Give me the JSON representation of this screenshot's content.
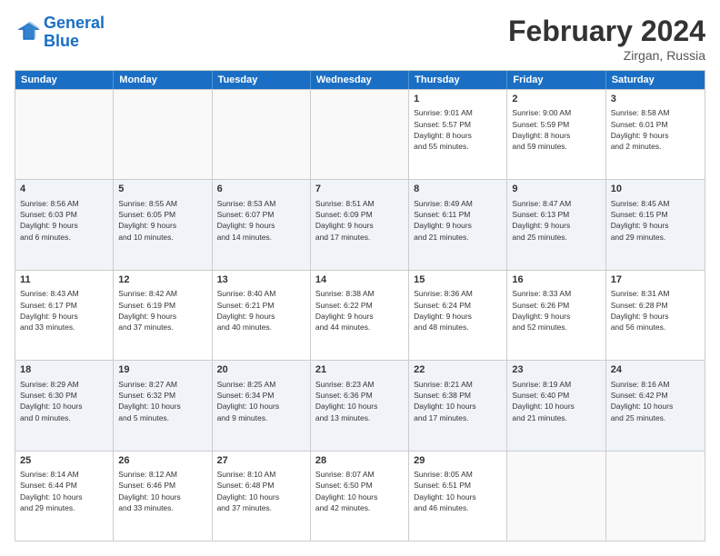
{
  "logo": {
    "line1": "General",
    "line2": "Blue"
  },
  "title": "February 2024",
  "location": "Zirgan, Russia",
  "days_of_week": [
    "Sunday",
    "Monday",
    "Tuesday",
    "Wednesday",
    "Thursday",
    "Friday",
    "Saturday"
  ],
  "rows": [
    [
      {
        "day": "",
        "info": ""
      },
      {
        "day": "",
        "info": ""
      },
      {
        "day": "",
        "info": ""
      },
      {
        "day": "",
        "info": ""
      },
      {
        "day": "1",
        "info": "Sunrise: 9:01 AM\nSunset: 5:57 PM\nDaylight: 8 hours\nand 55 minutes."
      },
      {
        "day": "2",
        "info": "Sunrise: 9:00 AM\nSunset: 5:59 PM\nDaylight: 8 hours\nand 59 minutes."
      },
      {
        "day": "3",
        "info": "Sunrise: 8:58 AM\nSunset: 6:01 PM\nDaylight: 9 hours\nand 2 minutes."
      }
    ],
    [
      {
        "day": "4",
        "info": "Sunrise: 8:56 AM\nSunset: 6:03 PM\nDaylight: 9 hours\nand 6 minutes."
      },
      {
        "day": "5",
        "info": "Sunrise: 8:55 AM\nSunset: 6:05 PM\nDaylight: 9 hours\nand 10 minutes."
      },
      {
        "day": "6",
        "info": "Sunrise: 8:53 AM\nSunset: 6:07 PM\nDaylight: 9 hours\nand 14 minutes."
      },
      {
        "day": "7",
        "info": "Sunrise: 8:51 AM\nSunset: 6:09 PM\nDaylight: 9 hours\nand 17 minutes."
      },
      {
        "day": "8",
        "info": "Sunrise: 8:49 AM\nSunset: 6:11 PM\nDaylight: 9 hours\nand 21 minutes."
      },
      {
        "day": "9",
        "info": "Sunrise: 8:47 AM\nSunset: 6:13 PM\nDaylight: 9 hours\nand 25 minutes."
      },
      {
        "day": "10",
        "info": "Sunrise: 8:45 AM\nSunset: 6:15 PM\nDaylight: 9 hours\nand 29 minutes."
      }
    ],
    [
      {
        "day": "11",
        "info": "Sunrise: 8:43 AM\nSunset: 6:17 PM\nDaylight: 9 hours\nand 33 minutes."
      },
      {
        "day": "12",
        "info": "Sunrise: 8:42 AM\nSunset: 6:19 PM\nDaylight: 9 hours\nand 37 minutes."
      },
      {
        "day": "13",
        "info": "Sunrise: 8:40 AM\nSunset: 6:21 PM\nDaylight: 9 hours\nand 40 minutes."
      },
      {
        "day": "14",
        "info": "Sunrise: 8:38 AM\nSunset: 6:22 PM\nDaylight: 9 hours\nand 44 minutes."
      },
      {
        "day": "15",
        "info": "Sunrise: 8:36 AM\nSunset: 6:24 PM\nDaylight: 9 hours\nand 48 minutes."
      },
      {
        "day": "16",
        "info": "Sunrise: 8:33 AM\nSunset: 6:26 PM\nDaylight: 9 hours\nand 52 minutes."
      },
      {
        "day": "17",
        "info": "Sunrise: 8:31 AM\nSunset: 6:28 PM\nDaylight: 9 hours\nand 56 minutes."
      }
    ],
    [
      {
        "day": "18",
        "info": "Sunrise: 8:29 AM\nSunset: 6:30 PM\nDaylight: 10 hours\nand 0 minutes."
      },
      {
        "day": "19",
        "info": "Sunrise: 8:27 AM\nSunset: 6:32 PM\nDaylight: 10 hours\nand 5 minutes."
      },
      {
        "day": "20",
        "info": "Sunrise: 8:25 AM\nSunset: 6:34 PM\nDaylight: 10 hours\nand 9 minutes."
      },
      {
        "day": "21",
        "info": "Sunrise: 8:23 AM\nSunset: 6:36 PM\nDaylight: 10 hours\nand 13 minutes."
      },
      {
        "day": "22",
        "info": "Sunrise: 8:21 AM\nSunset: 6:38 PM\nDaylight: 10 hours\nand 17 minutes."
      },
      {
        "day": "23",
        "info": "Sunrise: 8:19 AM\nSunset: 6:40 PM\nDaylight: 10 hours\nand 21 minutes."
      },
      {
        "day": "24",
        "info": "Sunrise: 8:16 AM\nSunset: 6:42 PM\nDaylight: 10 hours\nand 25 minutes."
      }
    ],
    [
      {
        "day": "25",
        "info": "Sunrise: 8:14 AM\nSunset: 6:44 PM\nDaylight: 10 hours\nand 29 minutes."
      },
      {
        "day": "26",
        "info": "Sunrise: 8:12 AM\nSunset: 6:46 PM\nDaylight: 10 hours\nand 33 minutes."
      },
      {
        "day": "27",
        "info": "Sunrise: 8:10 AM\nSunset: 6:48 PM\nDaylight: 10 hours\nand 37 minutes."
      },
      {
        "day": "28",
        "info": "Sunrise: 8:07 AM\nSunset: 6:50 PM\nDaylight: 10 hours\nand 42 minutes."
      },
      {
        "day": "29",
        "info": "Sunrise: 8:05 AM\nSunset: 6:51 PM\nDaylight: 10 hours\nand 46 minutes."
      },
      {
        "day": "",
        "info": ""
      },
      {
        "day": "",
        "info": ""
      }
    ]
  ]
}
